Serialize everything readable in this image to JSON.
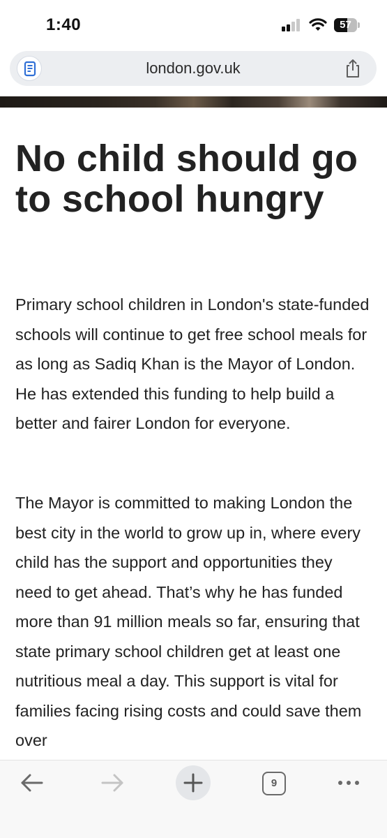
{
  "status_bar": {
    "time": "1:40",
    "battery_percent": 57,
    "battery_label": "57",
    "signal_bars_active": 2,
    "signal_bars_total": 4
  },
  "browser": {
    "url": "london.gov.uk",
    "reader_icon": "document-icon",
    "share_icon": "share-icon"
  },
  "article": {
    "headline": "No child should go to school hungry",
    "paragraphs": [
      "Primary school children in London's state-funded schools will continue to get free school meals for as long as Sadiq Khan is the Mayor of London. He has extended this funding to help build a better and fairer London for everyone.",
      "The Mayor is committed to making London the best city in the world to grow up in, where every child has the support and opportunities they need to get ahead. That’s why he has funded more than 91 million meals so far, ensuring that state primary school children get at least one nutritious meal a day. This support is vital for families facing rising costs and could save them over"
    ]
  },
  "toolbar": {
    "tab_count": "9",
    "icons": [
      "back-arrow-icon",
      "forward-arrow-icon",
      "plus-icon",
      "tabs-icon",
      "more-icon"
    ]
  },
  "colors": {
    "text": "#222222",
    "url_bar": "#eceef1",
    "reader_icon_accent": "#2f6fd6",
    "toolbar_background": "#f8f8f8"
  }
}
